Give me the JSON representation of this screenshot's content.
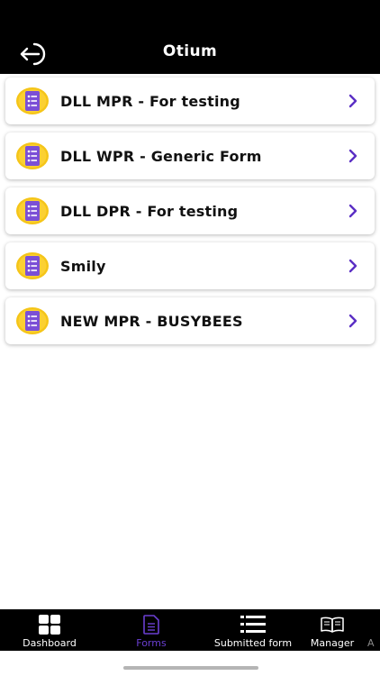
{
  "header": {
    "title": "Otium",
    "back_icon": "back-arrow-icon"
  },
  "forms": [
    {
      "label": "DLL MPR - For testing",
      "icon": "form-document-icon"
    },
    {
      "label": "DLL WPR - Generic Form",
      "icon": "form-document-icon"
    },
    {
      "label": "DLL DPR - For testing",
      "icon": "form-document-icon"
    },
    {
      "label": "Smily",
      "icon": "form-document-icon"
    },
    {
      "label": "NEW MPR - BUSYBEES",
      "icon": "form-document-icon"
    }
  ],
  "tabbar": {
    "tabs": [
      {
        "label": "Dashboard",
        "icon": "dashboard-grid-icon",
        "active": false
      },
      {
        "label": "Forms",
        "icon": "forms-document-icon",
        "active": true
      },
      {
        "label": "Submitted form",
        "icon": "list-icon",
        "active": false
      },
      {
        "label": "Manager",
        "icon": "book-icon",
        "active": false
      },
      {
        "label": "A",
        "icon": "",
        "active": false
      }
    ]
  },
  "colors": {
    "header_bg": "#000000",
    "accent_purple": "#6a3fd1",
    "icon_circle": "#f5c518",
    "icon_doc": "#7b4fd6",
    "chevron": "#5b2fc4"
  }
}
